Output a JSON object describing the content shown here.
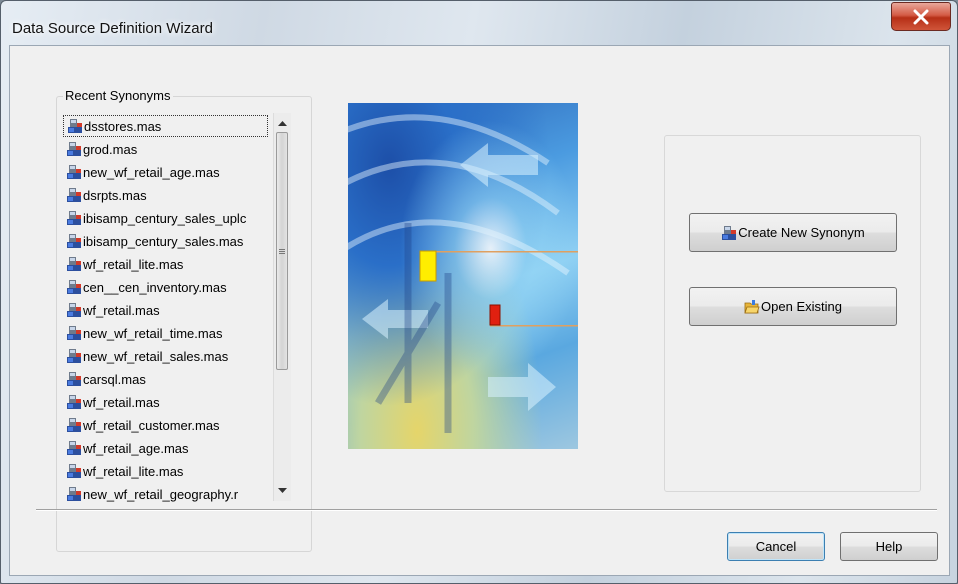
{
  "window": {
    "title": "Data Source Definition Wizard",
    "close_label": "close"
  },
  "recent_synonyms": {
    "legend": "Recent Synonyms",
    "selected_index": 0,
    "items": [
      "dsstores.mas",
      "grod.mas",
      "new_wf_retail_age.mas",
      "dsrpts.mas",
      "ibisamp_century_sales_uplc",
      "ibisamp_century_sales.mas",
      "wf_retail_lite.mas",
      "cen__cen_inventory.mas",
      "wf_retail.mas",
      "new_wf_retail_time.mas",
      "new_wf_retail_sales.mas",
      "carsql.mas",
      "wf_retail.mas",
      "wf_retail_customer.mas",
      "wf_retail_age.mas",
      "wf_retail_lite.mas",
      "new_wf_retail_geography.r"
    ]
  },
  "actions": {
    "create_new_synonym": "Create New Synonym",
    "open_existing": "Open Existing"
  },
  "footer": {
    "cancel": "Cancel",
    "help": "Help"
  },
  "colors": {
    "accent": "#3c7fb1",
    "close_red": "#c9412a",
    "marker_yellow": "#ffee00",
    "marker_red": "#e02010"
  },
  "icons": {
    "synonym": "synonym-icon",
    "open_folder": "open-folder-icon",
    "close": "close-icon"
  }
}
